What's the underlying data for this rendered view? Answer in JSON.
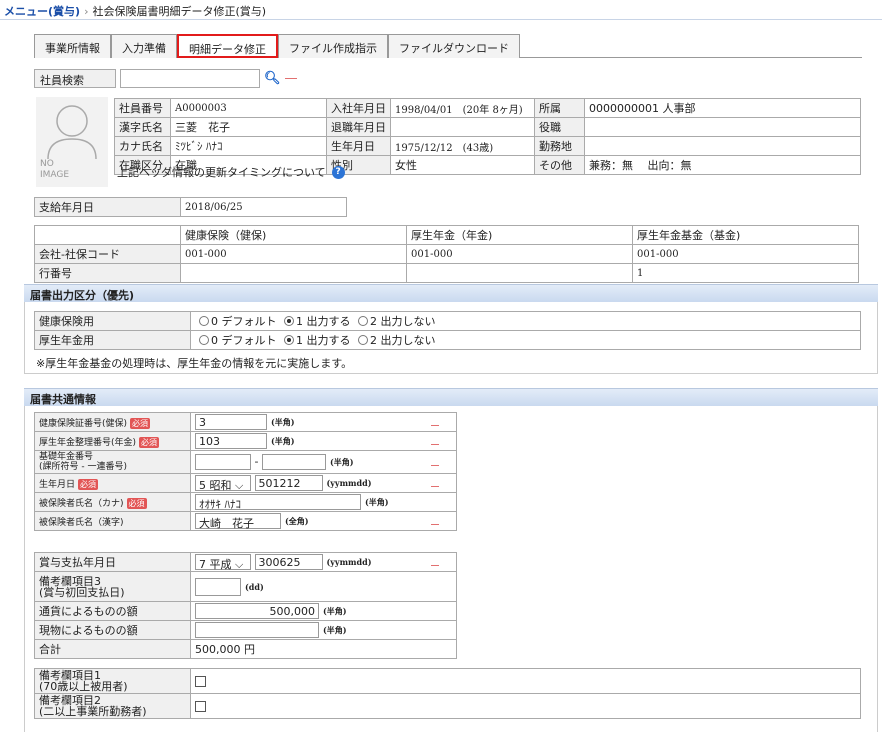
{
  "breadcrumb": {
    "root": "メニュー(賞与)",
    "separator": "›",
    "current": "社会保険届書明細データ修正(賞与)"
  },
  "tabs": [
    "事業所情報",
    "入力準備",
    "明細データ修正",
    "ファイル作成指示",
    "ファイルダウンロード"
  ],
  "search": {
    "label": "社員検索",
    "value": ""
  },
  "avatar": {
    "line1": "NO",
    "line2": "IMAGE"
  },
  "employee": {
    "id_label": "社員番号",
    "id": "A0000003",
    "name_label": "漢字氏名",
    "name": "三菱　花子",
    "kana_label": "カナ氏名",
    "kana": "ﾐﾂﾋﾞｼ ﾊﾅｺ",
    "status_label": "在職区分",
    "status": "在職",
    "join_label": "入社年月日",
    "join": "1998/04/01　(20年 8ヶ月)",
    "leave_label": "退職年月日",
    "leave": "",
    "birth_label": "生年月日",
    "birth": "1975/12/12　(43歳)",
    "sex_label": "性別",
    "sex": "女性",
    "dept_label": "所属",
    "dept": "0000000001 人事部",
    "post_label": "役職",
    "post": "",
    "place_label": "勤務地",
    "place": "",
    "other_label": "その他",
    "other": "兼務：無　 出向：無"
  },
  "header_note": "上記ヘッダ情報の更新タイミングについて",
  "pay_date": {
    "label": "支給年月日",
    "value": "2018/06/25"
  },
  "codes": {
    "columns": [
      "健康保険（健保)",
      "厚生年金（年金)",
      "厚生年金基金（基金)"
    ],
    "row1_label": "会社-社保コード",
    "row1": [
      "001-000",
      "001-000",
      "001-000"
    ],
    "row2_label": "行番号",
    "row2": [
      "",
      "",
      "1"
    ]
  },
  "output_section": {
    "title": "届書出力区分（優先)",
    "rows": [
      {
        "label": "健康保険用",
        "opt0": "0 デフォルト",
        "opt1": "1 出力する",
        "opt2": "2 出力しない"
      },
      {
        "label": "厚生年金用",
        "opt0": "0 デフォルト",
        "opt1": "1 出力する",
        "opt2": "2 出力しない"
      }
    ],
    "note": "※厚生年金基金の処理時は、厚生年金の情報を元に実施します。"
  },
  "common_section": {
    "title": "届書共通情報",
    "required": "必須",
    "insurance_no": {
      "label": "健康保険証番号(健保)",
      "value": "3",
      "unit": "(半角)"
    },
    "pension_mgmt": {
      "label": "厚生年金整理番号(年金)",
      "value": "103",
      "unit": "(半角)"
    },
    "basic_pension": {
      "label1": "基礎年金番号",
      "label2": "(課所符号 - 一連番号)",
      "value1": "",
      "value2": "",
      "dash": "-",
      "unit": "(半角)"
    },
    "birth": {
      "label": "生年月日",
      "era": "5 昭和",
      "value": "501212",
      "unit": "(yymmdd)"
    },
    "name_kana": {
      "label": "被保険者氏名（カナ)",
      "value": "ｵｵｻｷ ﾊﾅｺ",
      "unit": "(半角)"
    },
    "name_kanji": {
      "label": "被保険者氏名（漢字)",
      "value": "大崎　花子",
      "unit": "(全角)"
    },
    "bonus_date": {
      "label": "賞与支払年月日",
      "era": "7 平成",
      "value": "300625",
      "unit": "(yymmdd)"
    },
    "remark3": {
      "label1": "備考欄項目3",
      "label2": "(賞与初回支払日)",
      "value": "",
      "unit": "(dd)"
    },
    "currency": {
      "label": "通貨によるものの額",
      "value": "500,000",
      "unit": "(半角)"
    },
    "kind": {
      "label": "現物によるものの額",
      "value": "",
      "unit": "(半角)"
    },
    "total": {
      "label": "合計",
      "value": "500,000 円"
    },
    "remark1": {
      "label1": "備考欄項目1",
      "label2": "(70歳以上被用者)"
    },
    "remark2": {
      "label1": "備考欄項目2",
      "label2": "(二以上事業所勤務者)"
    }
  }
}
